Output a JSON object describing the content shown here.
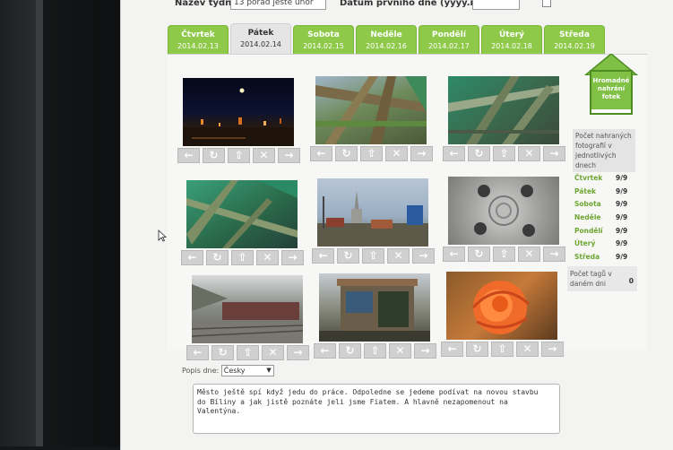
{
  "header": {
    "week_label": "Název týdne:",
    "week_value": "13 pořad ještě únor",
    "date_label": "Datum prvního dne (yyyy.mm.dd):"
  },
  "tabs": [
    {
      "name": "Čtvrtek",
      "date": "2014.02.13",
      "active": false
    },
    {
      "name": "Pátek",
      "date": "2014.02.14",
      "active": true
    },
    {
      "name": "Sobota",
      "date": "2014.02.15",
      "active": false
    },
    {
      "name": "Neděle",
      "date": "2014.02.16",
      "active": false
    },
    {
      "name": "Pondělí",
      "date": "2014.02.17",
      "active": false
    },
    {
      "name": "Úterý",
      "date": "2014.02.18",
      "active": false
    },
    {
      "name": "Středa",
      "date": "2014.02.19",
      "active": false
    }
  ],
  "photos": [
    {
      "subject": "night town with lights"
    },
    {
      "subject": "wooden roof beams"
    },
    {
      "subject": "green beams underside"
    },
    {
      "subject": "green roof trusses"
    },
    {
      "subject": "church tower town"
    },
    {
      "subject": "car wheel hubcap"
    },
    {
      "subject": "freight train"
    },
    {
      "subject": "small shop kiosk"
    },
    {
      "subject": "orange rose"
    }
  ],
  "photo_buttons": [
    "←",
    "↻",
    "⇧",
    "✕",
    "→"
  ],
  "upload": {
    "line1": "Hromadné",
    "line2": "nahrání",
    "line3": "fotek"
  },
  "stats": {
    "title_1": "Počet nahraných",
    "title_2": "fotografií v",
    "title_3": "jednotlivých dnech",
    "days": [
      {
        "day": "Čtvrtek",
        "count": "9/9"
      },
      {
        "day": "Pátek",
        "count": "9/9"
      },
      {
        "day": "Sobota",
        "count": "9/9"
      },
      {
        "day": "Neděle",
        "count": "9/9"
      },
      {
        "day": "Pondělí",
        "count": "9/9"
      },
      {
        "day": "Úterý",
        "count": "9/9"
      },
      {
        "day": "Středa",
        "count": "9/9"
      }
    ]
  },
  "tags": {
    "label_1": "Počet tagů v",
    "label_2": "daném dni",
    "value": "0"
  },
  "description": {
    "label": "Popis dne:",
    "language": "Česky",
    "text_1": "Město ještě spí když jedu do práce. Odpoledne se jedeme podívat na novou stavbu",
    "text_2": "do Bíliny a jak jistě poznáte jeli jsme Fiatem. A hlavně nezapomenout na",
    "text_3": "Valentýna."
  },
  "colors": {
    "tab_green": "#8fc94a",
    "day_green": "#6da632"
  }
}
